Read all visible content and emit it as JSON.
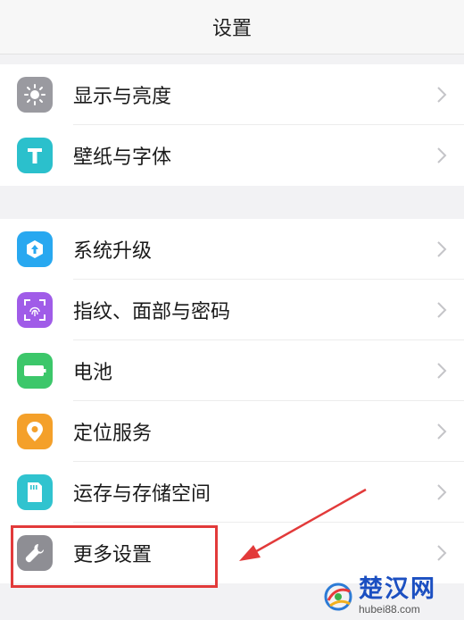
{
  "header": {
    "title": "设置"
  },
  "group1": {
    "items": [
      {
        "label": "显示与亮度",
        "icon": "display-brightness-icon",
        "color": "#9a9aa0"
      },
      {
        "label": "壁纸与字体",
        "icon": "wallpaper-font-icon",
        "color": "#2bc0cc"
      }
    ]
  },
  "group2": {
    "items": [
      {
        "label": "系统升级",
        "icon": "system-update-icon",
        "color": "#28a8f0"
      },
      {
        "label": "指纹、面部与密码",
        "icon": "fingerprint-face-password-icon",
        "color": "#a05ce8"
      },
      {
        "label": "电池",
        "icon": "battery-icon",
        "color": "#3cc76a"
      },
      {
        "label": "定位服务",
        "icon": "location-icon",
        "color": "#f4a02a"
      },
      {
        "label": "运存与存储空间",
        "icon": "storage-icon",
        "color": "#30c3cf"
      },
      {
        "label": "更多设置",
        "icon": "wrench-icon",
        "color": "#8e8e94"
      }
    ]
  },
  "annotation": {
    "highlight_color": "#e23a3a"
  },
  "watermark": {
    "brand": "楚汉网",
    "url": "hubei88.com"
  }
}
